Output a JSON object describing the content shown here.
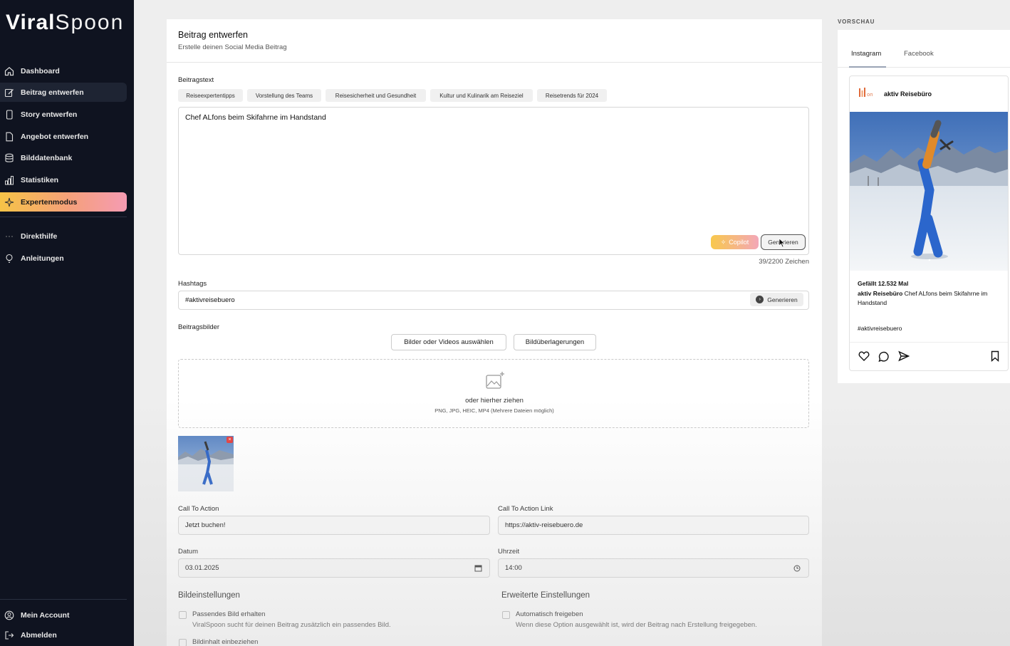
{
  "brand": {
    "logo_bold": "Viral",
    "logo_light": "Spoon"
  },
  "sidebar": {
    "items": [
      {
        "label": "Dashboard",
        "icon": "home-icon"
      },
      {
        "label": "Beitrag entwerfen",
        "icon": "edit-icon",
        "active": true
      },
      {
        "label": "Story entwerfen",
        "icon": "phone-icon"
      },
      {
        "label": "Angebot entwerfen",
        "icon": "document-icon"
      },
      {
        "label": "Bilddatenbank",
        "icon": "database-icon"
      },
      {
        "label": "Statistiken",
        "icon": "bar-chart-icon"
      },
      {
        "label": "Expertenmodus",
        "icon": "sparkle-icon",
        "highlight": true
      }
    ],
    "help_items": [
      {
        "label": "Direkthilfe",
        "icon": "dots-icon"
      },
      {
        "label": "Anleitungen",
        "icon": "lightbulb-icon"
      }
    ],
    "bottom_items": [
      {
        "label": "Mein Account",
        "icon": "user-icon"
      },
      {
        "label": "Abmelden",
        "icon": "logout-icon"
      }
    ]
  },
  "editor": {
    "title": "Beitrag entwerfen",
    "subtitle": "Erstelle deinen Social Media Beitrag",
    "text_label": "Beitragstext",
    "topic_chips": [
      "Reiseexpertentipps",
      "Vorstellung des Teams",
      "Reisesicherheit und Gesundheit",
      "Kultur und Kulinarik am Reiseziel",
      "Reisetrends für 2024"
    ],
    "text_value": "Chef ALfons beim Skifahrne im Handstand",
    "copilot_label": "Copilot",
    "generate_label": "Generieren",
    "char_counter": "39/2200 Zeichen",
    "hashtags_label": "Hashtags",
    "hashtags_value": "#aktivreisebuero",
    "hashtags_generate": "Generieren",
    "images_label": "Beitragsbilder",
    "select_media_button": "Bilder oder Videos auswählen",
    "overlay_button": "Bildüberlagerungen",
    "drop_text": "oder hierher ziehen",
    "drop_formats": "PNG, JPG, HEIC, MP4 (Mehrere Dateien möglich)",
    "cta_label": "Call To Action",
    "cta_value": "Jetzt buchen!",
    "cta_link_label": "Call To Action Link",
    "cta_link_value": "https://aktiv-reisebuero.de",
    "date_label": "Datum",
    "date_value": "03.01.2025",
    "time_label": "Uhrzeit",
    "time_value": "14:00",
    "image_settings_title": "Bildeinstellungen",
    "advanced_settings_title": "Erweiterte Einstellungen",
    "opt_matching_image_title": "Passendes Bild erhalten",
    "opt_matching_image_desc": "ViralSpoon sucht für deinen Beitrag zusätzlich ein passendes Bild.",
    "opt_image_content_title": "Bildinhalt einbeziehen",
    "opt_auto_release_title": "Automatisch freigeben",
    "opt_auto_release_desc": "Wenn diese Option ausgewählt ist, wird der Beitrag nach Erstellung freigegeben."
  },
  "preview": {
    "section_label": "VORSCHAU",
    "tabs": [
      "Instagram",
      "Facebook"
    ],
    "account_name": "aktiv Reisebüro",
    "likes": "Gefällt 12.532 Mal",
    "caption_user": "aktiv Reisebüro",
    "caption_text": " Chef ALfons beim Skifahrne im Handstand",
    "hashtags": "#aktivreisebuero"
  },
  "colors": {
    "sidebar_bg": "#0f1320",
    "accent_gradient_start": "#f6c347",
    "accent_gradient_end": "#f59bb3"
  }
}
